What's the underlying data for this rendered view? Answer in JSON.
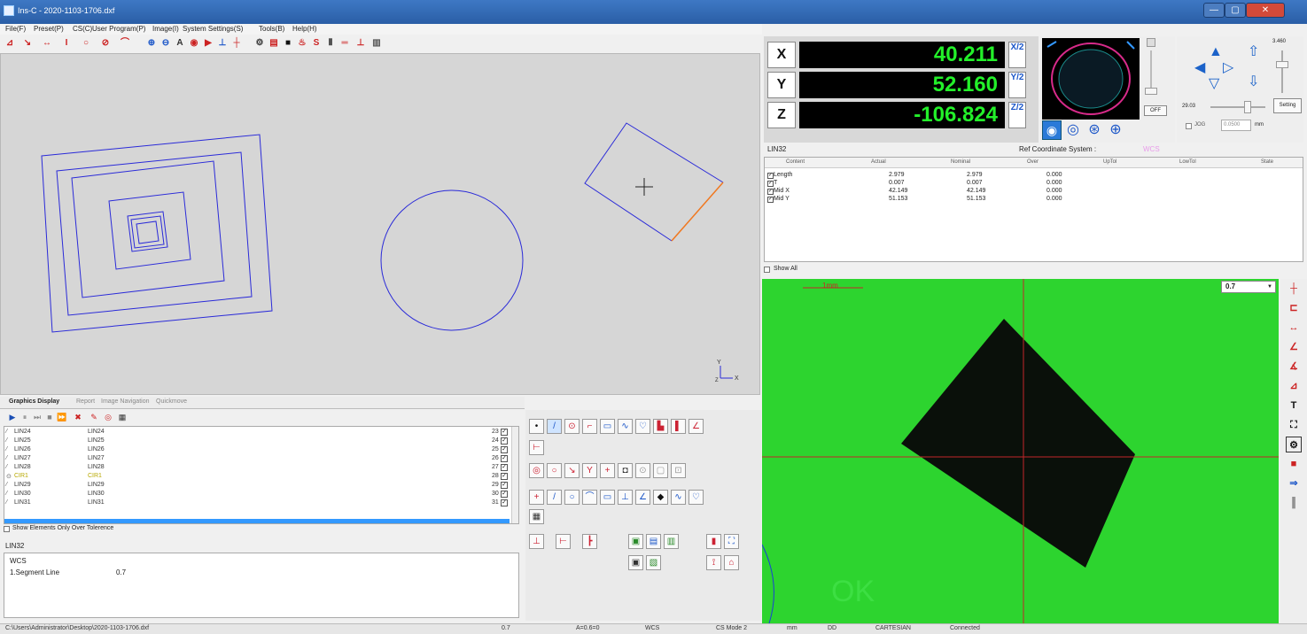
{
  "window": {
    "title": "Ins-C - 2020-1103-1706.dxf",
    "min": "—",
    "max": "▢",
    "close": "✕"
  },
  "menu": [
    "File(F)",
    "Preset(P)",
    "CS(C)",
    "User Program(P)",
    "Image(I)",
    "System Settings(S)",
    "Tools(B)",
    "Help(H)"
  ],
  "toolbar_icons": [
    "probe-icon",
    "point-icon",
    "distance-icon",
    "height-icon",
    "circle-icon",
    "no-circle-icon",
    "arc-icon",
    "zoom-in-icon",
    "zoom-out-icon",
    "text-icon",
    "layer-icon",
    "label-icon",
    "angle-icon",
    "cross-icon",
    "gear-icon",
    "copy-icon",
    "square-icon",
    "color-icon",
    "s-icon",
    "bi-icon",
    "align-icon",
    "baseline-icon",
    "ruler-icon"
  ],
  "canvas": {
    "axis_y": "Y",
    "axis_x": "X",
    "axis_z": "Z"
  },
  "tabs": [
    "Graphics Display",
    "Report",
    "Image Navigation",
    "Quickmove"
  ],
  "elements": [
    {
      "icon": "line-icon",
      "name": "LIN24",
      "ref": "LIN24",
      "num": "23"
    },
    {
      "icon": "line-icon",
      "name": "LIN25",
      "ref": "LIN25",
      "num": "24"
    },
    {
      "icon": "line-icon",
      "name": "LIN26",
      "ref": "LIN26",
      "num": "25"
    },
    {
      "icon": "line-icon",
      "name": "LIN27",
      "ref": "LIN27",
      "num": "26"
    },
    {
      "icon": "line-icon",
      "name": "LIN28",
      "ref": "LIN28",
      "num": "27"
    },
    {
      "icon": "circle-icon",
      "name": "CIR1",
      "ref": "CIR1",
      "num": "28"
    },
    {
      "icon": "line-icon",
      "name": "LIN29",
      "ref": "LIN29",
      "num": "29"
    },
    {
      "icon": "line-icon",
      "name": "LIN30",
      "ref": "LIN30",
      "num": "30"
    },
    {
      "icon": "line-icon",
      "name": "LIN31",
      "ref": "LIN31",
      "num": "31"
    }
  ],
  "show_over_tol": "Show Elements Only Over Tolerence",
  "info": {
    "feature": "LIN32",
    "cs": "WCS",
    "segment": "1.Segment Line",
    "segment_value": "0.7"
  },
  "dro": {
    "x_label": "X",
    "y_label": "Y",
    "z_label": "Z",
    "x": "40.211",
    "y": "52.160",
    "z": "-106.824",
    "x_half": "X/2",
    "y_half": "Y/2",
    "z_half": "Z/2",
    "value_color": "#23f02a"
  },
  "light": {
    "off": "OFF",
    "zero": "0"
  },
  "nav": {
    "speed_max": "3.460",
    "speed_cur": "29.03",
    "setting": "Setting",
    "jog": "JOG",
    "jog_step": "0.0500",
    "unit": "mm"
  },
  "measurement": {
    "feature": "LIN32",
    "ref_label": "Ref Coordinate System :",
    "ref_value": "WCS",
    "columns": [
      "Content",
      "Actual",
      "Nominal",
      "Over",
      "UpTol",
      "LowTol",
      "State"
    ],
    "rows": [
      {
        "content": "Length",
        "actual": "2.979",
        "nominal": "2.979",
        "over": "0.000"
      },
      {
        "content": "T",
        "actual": "0.007",
        "nominal": "0.007",
        "over": "0.000"
      },
      {
        "content": "Mid X",
        "actual": "42.149",
        "nominal": "42.149",
        "over": "0.000"
      },
      {
        "content": "Mid Y",
        "actual": "51.153",
        "nominal": "51.153",
        "over": "0.000"
      }
    ],
    "show_all": "Show All"
  },
  "camera": {
    "zoom": "0.7",
    "scale": "1mm",
    "ok": "OK"
  },
  "status": {
    "path": "C:\\Users\\Administrator\\Desktop\\2020-1103-1706.dxf",
    "zoom": "0.7",
    "angle": "A=0.6=0",
    "cs": "WCS",
    "cs_mode": "CS Mode 2",
    "unit": "mm",
    "fmt": "DD",
    "coord": "CARTESIAN",
    "conn": "Connected"
  }
}
